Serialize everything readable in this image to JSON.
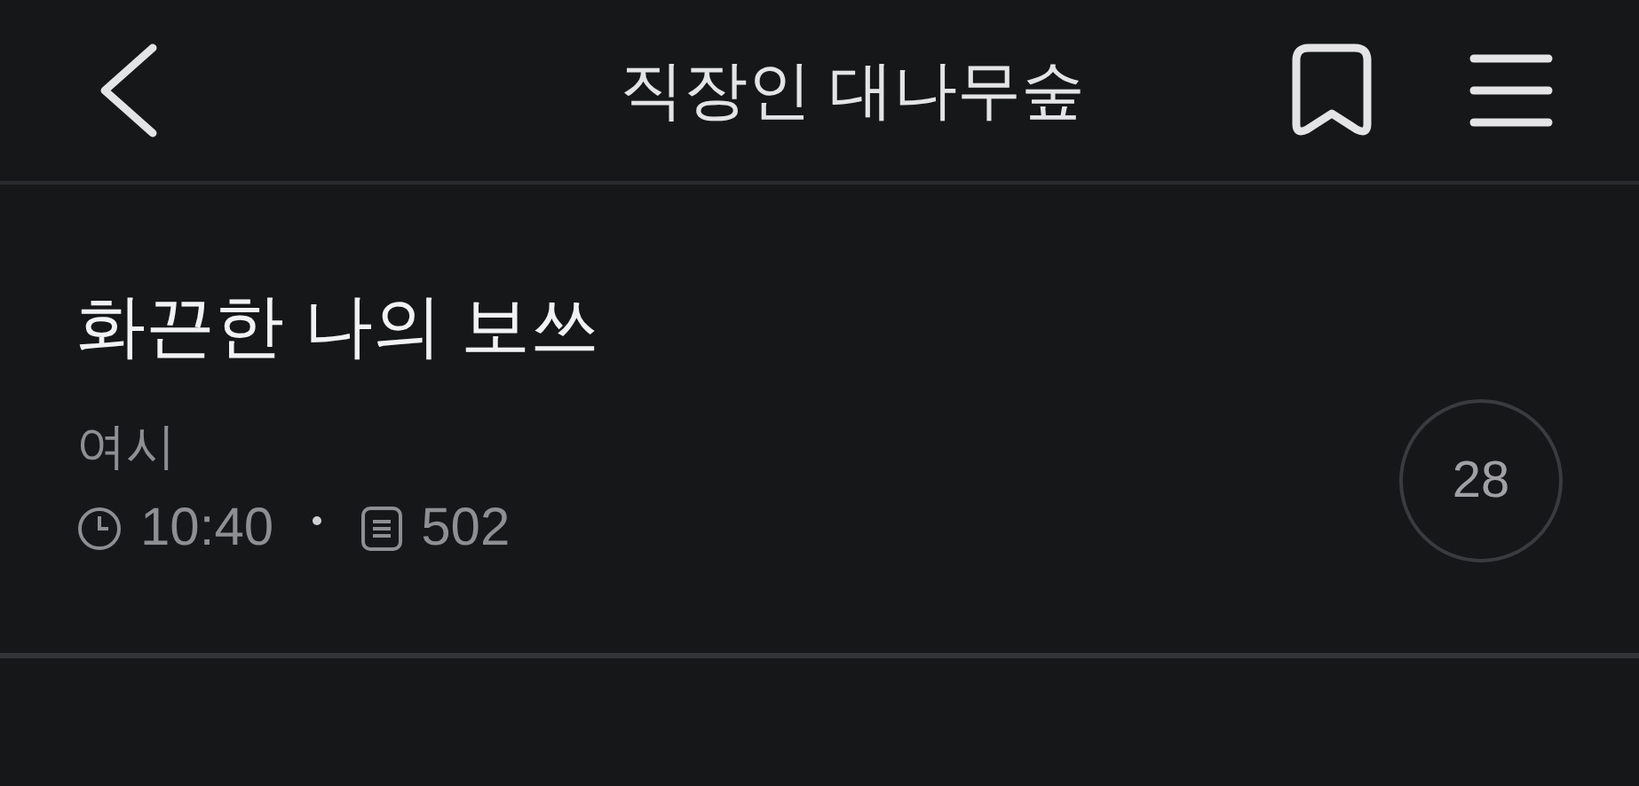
{
  "header": {
    "title": "직장인 대나무숲"
  },
  "post": {
    "title": "화끈한 나의 보쓰",
    "author": "여시",
    "time": "10:40",
    "views": "502",
    "comments": "28"
  }
}
